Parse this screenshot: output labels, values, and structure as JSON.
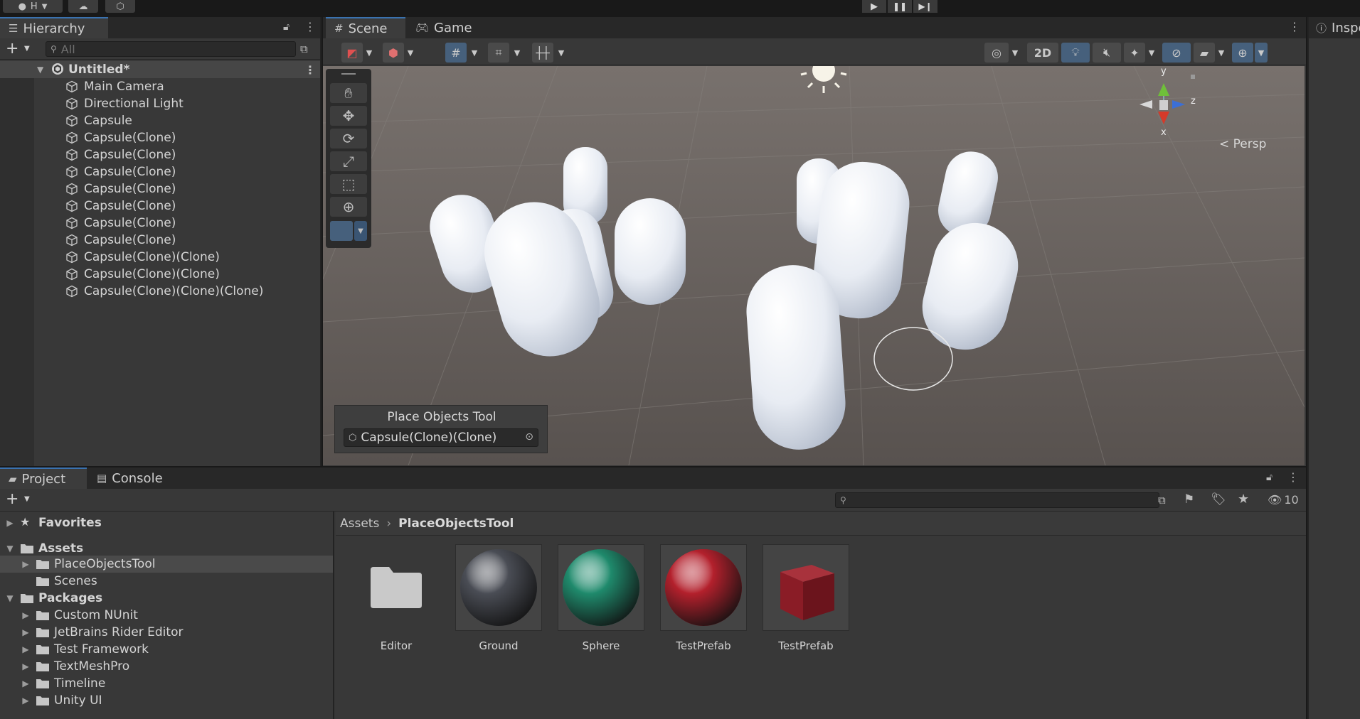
{
  "topbar": {
    "account_initial": "H"
  },
  "hierarchy": {
    "tab_label": "Hierarchy",
    "search_placeholder": "All",
    "scene_name": "Untitled*",
    "objects": [
      "Main Camera",
      "Directional Light",
      "Capsule",
      "Capsule(Clone)",
      "Capsule(Clone)",
      "Capsule(Clone)",
      "Capsule(Clone)",
      "Capsule(Clone)",
      "Capsule(Clone)",
      "Capsule(Clone)",
      "Capsule(Clone)(Clone)",
      "Capsule(Clone)(Clone)",
      "Capsule(Clone)(Clone)(Clone)"
    ]
  },
  "scene": {
    "tabs": [
      "Scene",
      "Game"
    ],
    "toolbar_2d_label": "2D",
    "gizmo_axes": {
      "y": "y",
      "z": "z",
      "x": "x"
    },
    "projection_label": "Persp",
    "overlay": {
      "title": "Place Objects Tool",
      "object_field": "Capsule(Clone)(Clone)"
    }
  },
  "inspector": {
    "tab_label": "Inspe"
  },
  "project": {
    "tabs": [
      "Project",
      "Console"
    ],
    "hidden_count": "10",
    "tree": [
      {
        "label": "Favorites",
        "bold": true,
        "expanded": false,
        "icon": "star-icon"
      },
      {
        "label": "Assets",
        "bold": true,
        "expanded": true,
        "icon": "folder-open-icon"
      },
      {
        "label": "PlaceObjectsTool",
        "selected": true,
        "icon": "folder-icon"
      },
      {
        "label": "Scenes",
        "icon": "folder-icon"
      },
      {
        "label": "Packages",
        "bold": true,
        "expanded": true,
        "icon": "folder-open-icon"
      },
      {
        "label": "Custom NUnit",
        "icon": "folder-icon"
      },
      {
        "label": "JetBrains Rider Editor",
        "icon": "folder-icon"
      },
      {
        "label": "Test Framework",
        "icon": "folder-icon"
      },
      {
        "label": "TextMeshPro",
        "icon": "folder-icon"
      },
      {
        "label": "Timeline",
        "icon": "folder-icon"
      },
      {
        "label": "Unity UI",
        "icon": "folder-icon"
      }
    ],
    "breadcrumb": [
      "Assets",
      "PlaceObjectsTool"
    ],
    "assets": [
      {
        "label": "Editor",
        "kind": "folder"
      },
      {
        "label": "Ground",
        "kind": "material",
        "color": "#4a4d55"
      },
      {
        "label": "Sphere",
        "kind": "material",
        "color": "#1f8a6c"
      },
      {
        "label": "TestPrefab",
        "kind": "material",
        "color": "#b3202c"
      },
      {
        "label": "TestPrefab",
        "kind": "prefab",
        "color": "#8a1c26"
      }
    ]
  }
}
